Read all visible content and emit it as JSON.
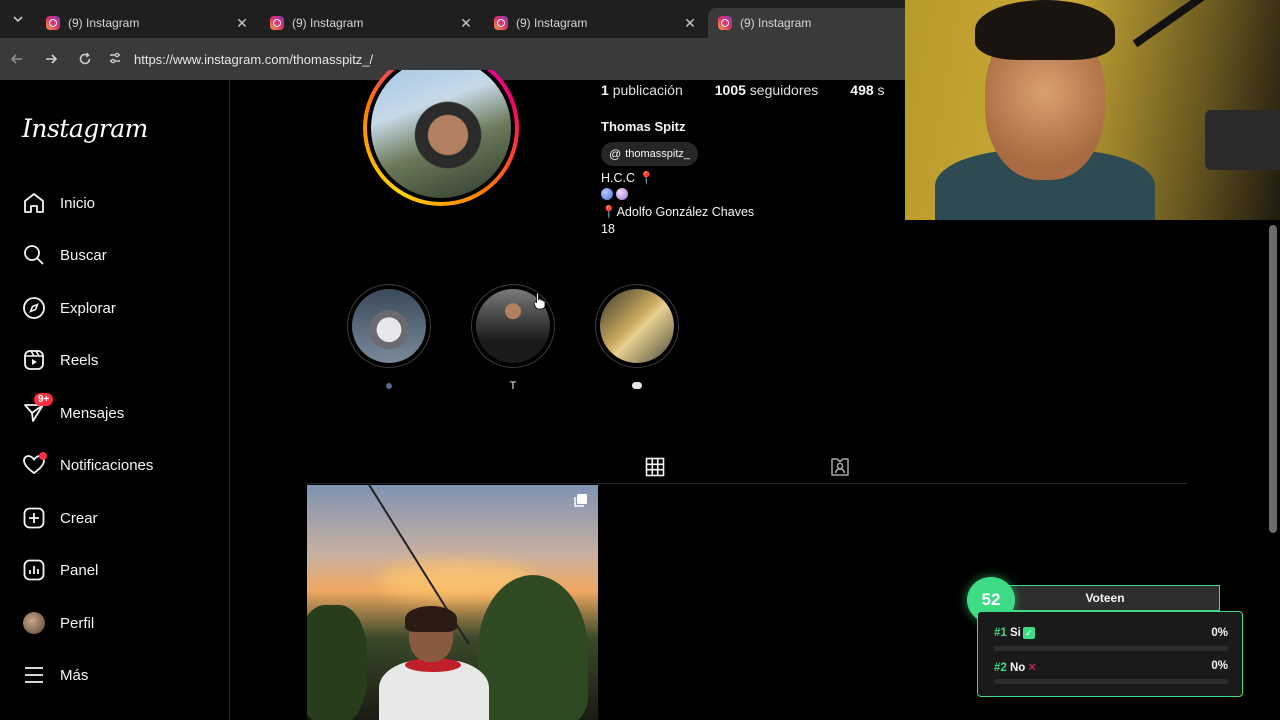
{
  "browser": {
    "tabs": [
      {
        "title": "(9) Instagram"
      },
      {
        "title": "(9) Instagram"
      },
      {
        "title": "(9) Instagram"
      },
      {
        "title": "(9) Instagram"
      }
    ],
    "url": "https://www.instagram.com/thomasspitz_/"
  },
  "sidebar": {
    "logo": "Instagram",
    "items": [
      {
        "label": "Inicio",
        "icon": "home-icon"
      },
      {
        "label": "Buscar",
        "icon": "search-icon"
      },
      {
        "label": "Explorar",
        "icon": "compass-icon"
      },
      {
        "label": "Reels",
        "icon": "reels-icon"
      },
      {
        "label": "Mensajes",
        "icon": "messenger-icon",
        "badge": "9+"
      },
      {
        "label": "Notificaciones",
        "icon": "heart-icon"
      },
      {
        "label": "Crear",
        "icon": "plus-square-icon"
      },
      {
        "label": "Panel",
        "icon": "chart-icon"
      },
      {
        "label": "Perfil",
        "icon": "avatar"
      },
      {
        "label": "Más",
        "icon": "menu-icon"
      }
    ]
  },
  "profile": {
    "stats": [
      {
        "value": "1",
        "label": "publicación"
      },
      {
        "value": "1005",
        "label": "seguidores"
      },
      {
        "value": "498",
        "label": "s"
      }
    ],
    "full_name": "Thomas Spitz",
    "threads_handle": "thomasspitz_",
    "bio_lines": [
      "H.C.C",
      "",
      "Adolfo González Chaves",
      "18"
    ]
  },
  "highlights": [
    {
      "label": ""
    },
    {
      "label": "T"
    },
    {
      "label": ""
    }
  ],
  "poll": {
    "count": "52",
    "title": "Voteen",
    "options": [
      {
        "num": "#1",
        "label": "Si",
        "percent": "0%"
      },
      {
        "num": "#2",
        "label": "No",
        "percent": "0%"
      }
    ]
  },
  "colors": {
    "accent_green": "#3ddc84",
    "notification_red": "#ff3040"
  }
}
